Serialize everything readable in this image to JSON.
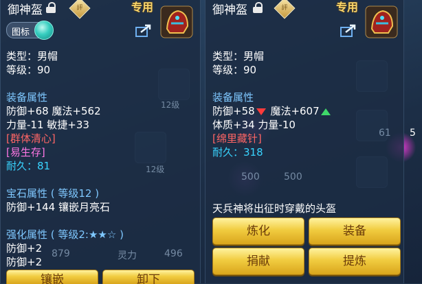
{
  "left": {
    "title": "御神盔",
    "exclusive_label": "专用",
    "badge_label": "評",
    "toggle_label": "图标",
    "type_line": "类型：男帽",
    "level_line": "等级：90",
    "equip_attr_header": "装备属性",
    "stat_line_1": "防御+68 魔法+562",
    "stat_line_2": "力量-11 敏捷+33",
    "special_1": "[群体清心]",
    "special_2": "[易生存]",
    "durability_label": "耐久：",
    "durability_value": "81",
    "gem_header": "宝石属性 ( 等级12 )",
    "gem_line": "防御+144 镶嵌月亮石",
    "enhance_header": "强化属性 ( 等级2:★★☆ )",
    "enhance_line_1": "防御+2",
    "enhance_line_2": "防御+2",
    "btn_1": "镶嵌",
    "btn_2": "卸下"
  },
  "right": {
    "title": "御神盔",
    "exclusive_label": "专用",
    "badge_label": "評",
    "type_line": "类型：男帽",
    "level_line": "等级：90",
    "equip_attr_header": "装备属性",
    "stat_defense": "防御+58",
    "stat_magic": "魔法+607",
    "stat_line_2": "体质+34 力量-10",
    "special_1": "[绵里藏针]",
    "durability_label": "耐久：",
    "durability_value": "318",
    "description": "天兵神将出征时穿戴的头盔",
    "btn_refine": "炼化",
    "btn_equip": "装备",
    "btn_donate": "捐献",
    "btn_extract": "提炼"
  },
  "background": {
    "slot_label_1": "12级",
    "slot_label_2": "12级",
    "num_500_a": "500",
    "num_500_b": "500",
    "num_61": "61",
    "num_879": "879",
    "spirit_label": "灵力",
    "num_496": "496",
    "num_5": "5"
  },
  "colors": {
    "section_header": "#7fc8ff",
    "red_special": "#ff6565",
    "pink_special": "#ff77e4",
    "durability": "#39d4ff",
    "button_gold": "#f1cc40"
  }
}
